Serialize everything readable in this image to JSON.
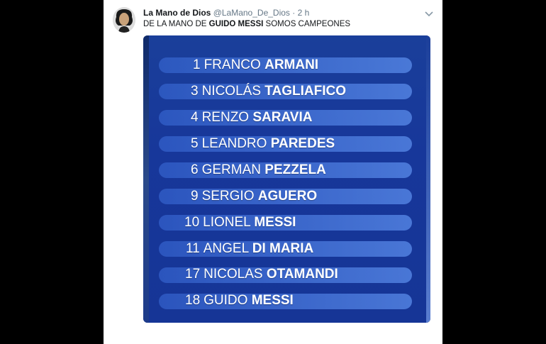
{
  "tweet": {
    "author_name": "La Mano de Dios",
    "handle": "@LaMano_De_Dios",
    "separator": "·",
    "time": "2 h",
    "text_before": "DE LA MANO DE ",
    "text_bold": "GUIDO MESSI",
    "text_after": " SOMOS CAMPEONES"
  },
  "lineup": [
    {
      "number": "1",
      "first": "FRANCO",
      "surname": "ARMANI"
    },
    {
      "number": "3",
      "first": "NICOLÁS",
      "surname": "TAGLIAFICO"
    },
    {
      "number": "4",
      "first": "RENZO",
      "surname": "SARAVIA"
    },
    {
      "number": "5",
      "first": "LEANDRO",
      "surname": "PAREDES"
    },
    {
      "number": "6",
      "first": "GERMAN",
      "surname": "PEZZELA"
    },
    {
      "number": "9",
      "first": "SERGIO",
      "surname": "AGUERO"
    },
    {
      "number": "10",
      "first": "LIONEL",
      "surname": "MESSI"
    },
    {
      "number": "11",
      "first": "ANGEL",
      "surname": "DI MARIA"
    },
    {
      "number": "17",
      "first": "NICOLAS",
      "surname": "OTAMANDI"
    },
    {
      "number": "18",
      "first": "GUIDO",
      "surname": "MESSI"
    }
  ],
  "colors": {
    "background": "#000000",
    "card": "#ffffff",
    "graphic_blue": "#17379a"
  }
}
